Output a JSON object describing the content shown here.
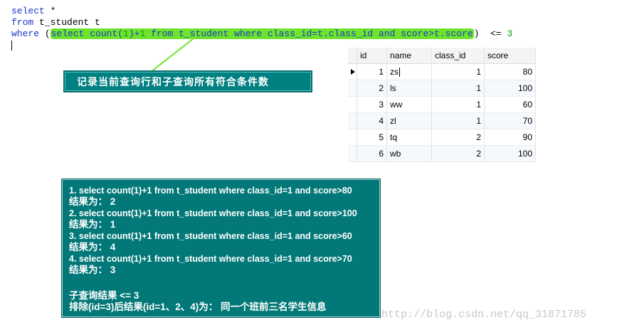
{
  "editor": {
    "line1": {
      "kw": "select",
      "rest": " *"
    },
    "line2": {
      "kw": "from",
      "rest": " t_student t"
    },
    "line3": {
      "kw": "where",
      "open_paren": " (",
      "sub_select": "select",
      "sub_count": " count(",
      "sub_one": "1",
      "sub_close": ")+",
      "sub_plus_one": "1",
      "sub_from": " from",
      "sub_table": " t_student",
      "sub_where": " where",
      "sub_cond1": " class_id=t.class_id",
      "sub_and": " and",
      "sub_cond2": " score>t.score",
      "close_paren": ")",
      "cmp": "  <= ",
      "cmp_val": "3"
    }
  },
  "callout": {
    "text": "记录当前查询行和子查询所有符合条件数"
  },
  "grid": {
    "columns": [
      "id",
      "name",
      "class_id",
      "score"
    ],
    "rows": [
      {
        "id": "1",
        "name": "zs",
        "class_id": "1",
        "score": "80"
      },
      {
        "id": "2",
        "name": "ls",
        "class_id": "1",
        "score": "100"
      },
      {
        "id": "3",
        "name": "ww",
        "class_id": "1",
        "score": "60"
      },
      {
        "id": "4",
        "name": "zl",
        "class_id": "1",
        "score": "70"
      },
      {
        "id": "5",
        "name": "tq",
        "class_id": "2",
        "score": "90"
      },
      {
        "id": "6",
        "name": "wb",
        "class_id": "2",
        "score": "100"
      }
    ]
  },
  "explain": {
    "q1": "1. select count(1)+1 from t_student where class_id=1 and score>80",
    "r1": "结果为：  2",
    "q2": "2. select count(1)+1 from t_student where class_id=1 and score>100",
    "r2": "结果为：  1",
    "q3": "3. select count(1)+1 from t_student where class_id=1 and score>60",
    "r3": "结果为：  4",
    "q4": "4. select count(1)+1 from t_student where class_id=1 and score>70",
    "r4": "结果为：  3",
    "summary1": "子查询结果 <= 3",
    "summary2": "排除(id=3)后结果(id=1、2、4)为：  同一个班前三名学生信息"
  },
  "watermark": "http://blog.csdn.net/qq_31871785",
  "colors": {
    "keyword": "#1d36c9",
    "number": "#0a9b0a",
    "highlight": "#6ee52c",
    "box": "#037878"
  }
}
